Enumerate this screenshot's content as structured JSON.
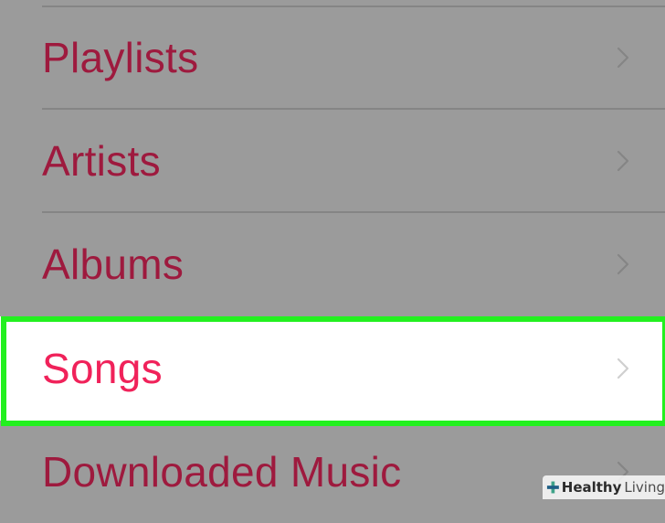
{
  "library_menu": {
    "items": [
      {
        "label": "Playlists"
      },
      {
        "label": "Artists"
      },
      {
        "label": "Albums"
      },
      {
        "label": "Songs",
        "highlighted": true
      },
      {
        "label": "Downloaded Music"
      }
    ]
  },
  "colors": {
    "label_dim": "#9e1a3e",
    "label_active": "#f0225a",
    "highlight_border": "#23f01f",
    "overlay_bg": "#9b9b9b"
  },
  "icons": {
    "row_chevron": "chevron-right-icon",
    "watermark": "plus-cross-icon"
  },
  "watermark": {
    "bold": "Healthy",
    "regular": "Living"
  }
}
